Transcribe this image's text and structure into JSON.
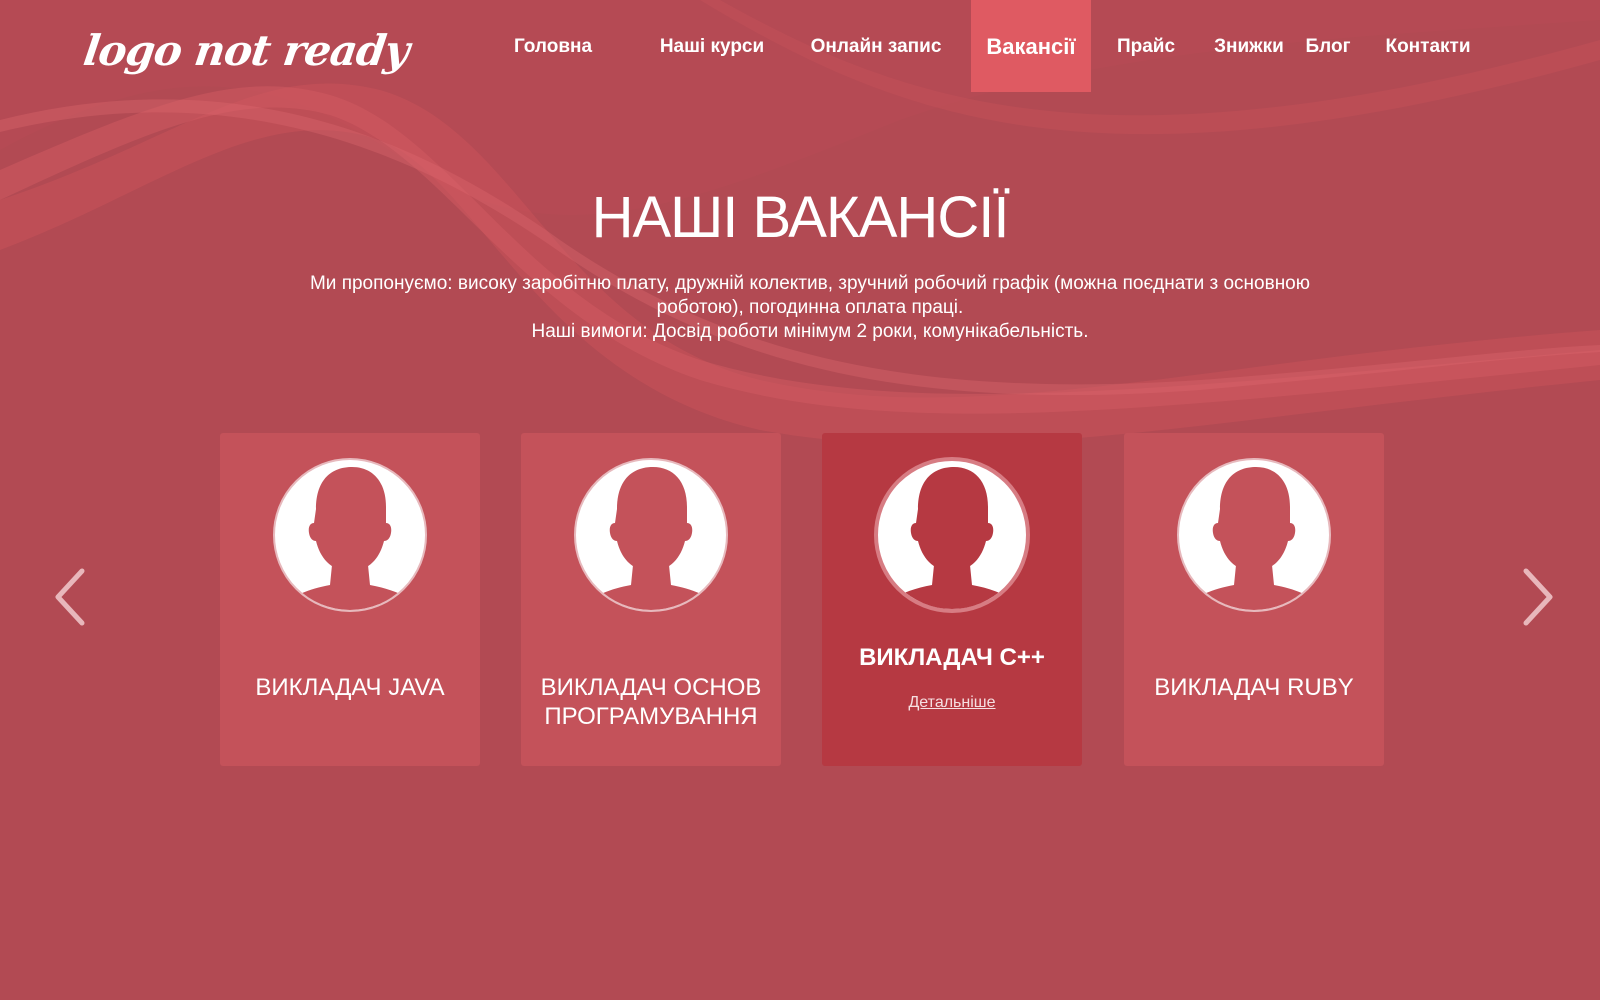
{
  "header": {
    "logo_text": "logo not ready",
    "nav": [
      {
        "label": "Головна"
      },
      {
        "label": "Наші курси"
      },
      {
        "label": "Онлайн запис"
      },
      {
        "label": "Вакансії"
      },
      {
        "label": "Прайс"
      },
      {
        "label": "Знижки"
      },
      {
        "label": "Блог"
      },
      {
        "label": "Контакти"
      }
    ],
    "active_nav": "Вакансії"
  },
  "hero": {
    "title": "НАШІ ВАКАНСІЇ",
    "desc_line1": "Ми пропонуємо: високу заробітню плату, дружній колектив, зручний робочий графік (можна поєднати з основною",
    "desc_line2": "роботою), погодинна оплата праці.",
    "desc_line3": "Наші вимоги: Досвід роботи мінімум 2 роки, комунікабельність."
  },
  "carousel": {
    "cards": [
      {
        "title": "Викладач JAVA"
      },
      {
        "title": "Викладач основ програмування"
      },
      {
        "title": "Викладач C++",
        "link": "Детальніше"
      },
      {
        "title": "Викладач RUBY"
      }
    ],
    "prev_icon": "chevron-left-icon",
    "next_icon": "chevron-right-icon"
  },
  "colors": {
    "background": "#b24a53",
    "card": "#c4525a",
    "card_active": "#b63942",
    "nav_active": "#df5a62",
    "text": "#ffffff"
  }
}
